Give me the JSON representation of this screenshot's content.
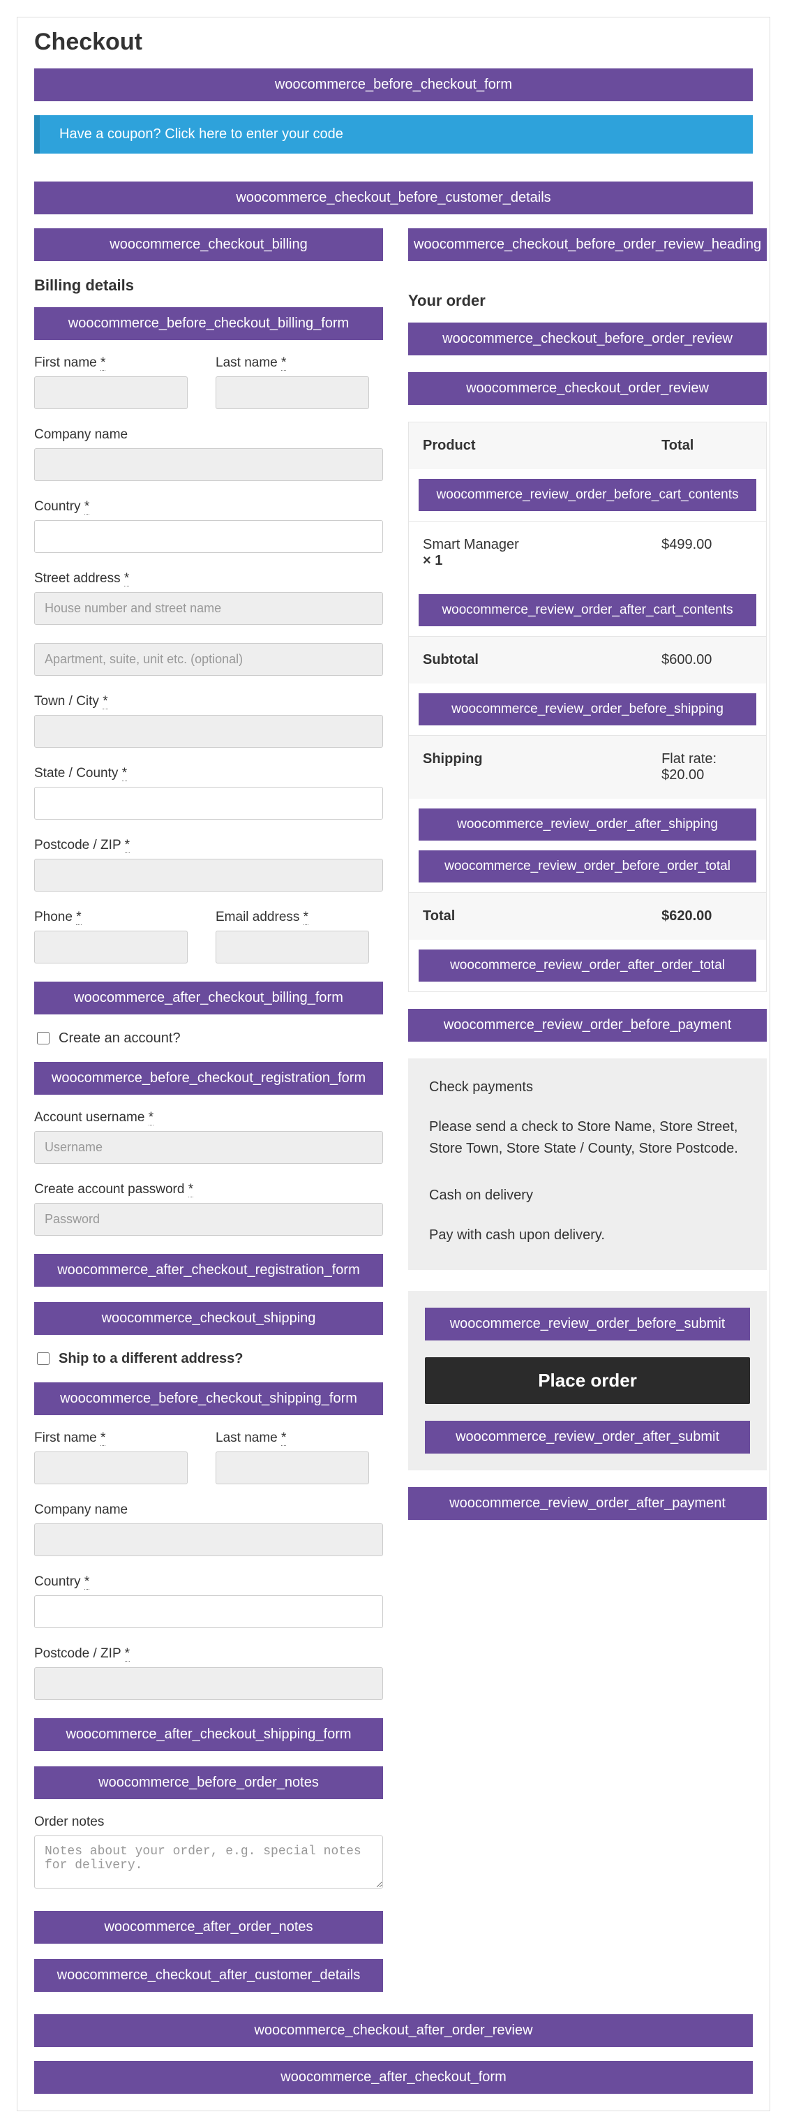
{
  "page": {
    "title": "Checkout"
  },
  "hooks": {
    "before_checkout_form": "woocommerce_before_checkout_form",
    "before_customer_details": "woocommerce_checkout_before_customer_details",
    "checkout_billing": "woocommerce_checkout_billing",
    "before_billing_form": "woocommerce_before_checkout_billing_form",
    "after_billing_form": "woocommerce_after_checkout_billing_form",
    "before_registration_form": "woocommerce_before_checkout_registration_form",
    "after_registration_form": "woocommerce_after_checkout_registration_form",
    "checkout_shipping": "woocommerce_checkout_shipping",
    "before_shipping_form": "woocommerce_before_checkout_shipping_form",
    "after_shipping_form": "woocommerce_after_checkout_shipping_form",
    "before_order_notes": "woocommerce_before_order_notes",
    "after_order_notes": "woocommerce_after_order_notes",
    "after_customer_details": "woocommerce_checkout_after_customer_details",
    "before_order_review_heading": "woocommerce_checkout_before_order_review_heading",
    "before_order_review": "woocommerce_checkout_before_order_review",
    "order_review": "woocommerce_checkout_order_review",
    "review_before_cart_contents": "woocommerce_review_order_before_cart_contents",
    "review_after_cart_contents": "woocommerce_review_order_after_cart_contents",
    "review_before_shipping": "woocommerce_review_order_before_shipping",
    "review_after_shipping": "woocommerce_review_order_after_shipping",
    "review_before_order_total": "woocommerce_review_order_before_order_total",
    "review_after_order_total": "woocommerce_review_order_after_order_total",
    "review_before_payment": "woocommerce_review_order_before_payment",
    "review_before_submit": "woocommerce_review_order_before_submit",
    "review_after_submit": "woocommerce_review_order_after_submit",
    "review_after_payment": "woocommerce_review_order_after_payment",
    "after_order_review": "woocommerce_checkout_after_order_review",
    "after_checkout_form": "woocommerce_after_checkout_form"
  },
  "coupon": {
    "text": "Have a coupon? Click here to enter your code"
  },
  "billing": {
    "heading": "Billing details",
    "first_name": "First name ",
    "last_name": "Last name ",
    "company": "Company name",
    "country": "Country ",
    "street": "Street address ",
    "street_ph": "House number and street name",
    "street2_ph": "Apartment, suite, unit etc. (optional)",
    "town": "Town / City ",
    "state": "State / County ",
    "postcode": "Postcode / ZIP ",
    "phone": "Phone ",
    "email": "Email address ",
    "req": "*"
  },
  "account": {
    "create_label": "Create an account?",
    "username_label": "Account username ",
    "username_ph": "Username",
    "password_label": "Create account password ",
    "password_ph": "Password"
  },
  "shipping": {
    "ship_diff": "Ship to a different address?",
    "first_name": "First name ",
    "last_name": "Last name ",
    "company": "Company name",
    "country": "Country ",
    "postcode": "Postcode / ZIP "
  },
  "notes": {
    "label": "Order notes",
    "ph": "Notes about your order, e.g. special notes for delivery."
  },
  "order": {
    "heading": "Your order",
    "th_product": "Product",
    "th_total": "Total",
    "item_name": "Smart Manager",
    "item_qty": "× 1",
    "item_total": "$499.00",
    "subtotal_label": "Subtotal",
    "subtotal_value": "$600.00",
    "shipping_label": "Shipping",
    "shipping_value": "Flat rate: $20.00",
    "total_label": "Total",
    "total_value": "$620.00"
  },
  "payment": {
    "check_title": "Check payments",
    "check_desc": "Please send a check to Store Name, Store Street, Store Town, Store State / County, Store Postcode.",
    "cod_title": "Cash on delivery",
    "cod_desc": "Pay with cash upon delivery.",
    "place_order": "Place order"
  }
}
